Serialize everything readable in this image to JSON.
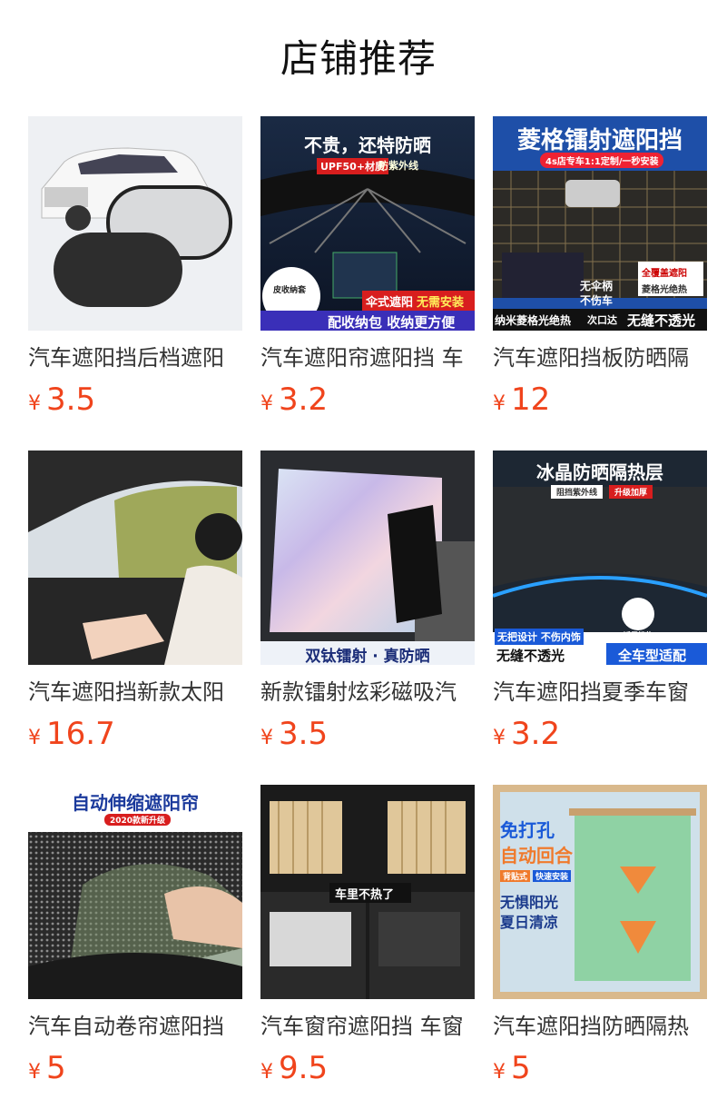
{
  "header": {
    "title": "店铺推荐"
  },
  "products": [
    {
      "title": "汽车遮阳挡后档遮阳",
      "currency": "¥",
      "price": "3.5",
      "image_text": []
    },
    {
      "title": "汽车遮阳帘遮阳挡 车",
      "currency": "¥",
      "price": "3.2",
      "image_text": [
        "不贵，还特防晒",
        "UPF50+材质",
        "防紫外线",
        "皮收纳套",
        "伞式遮阳",
        "无需安装",
        "配收纳包 收纳更方便"
      ]
    },
    {
      "title": "汽车遮阳挡板防晒隔",
      "currency": "¥",
      "price": "12",
      "image_text": [
        "菱格镭射遮阳挡",
        "4s店专车1:1定制/一秒安装",
        "无伞柄",
        "不伤车",
        "全覆盖遮阳",
        "菱格光绝热",
        "纳米菱格光绝热",
        "次口达",
        "无缝不透光"
      ]
    },
    {
      "title": "汽车遮阳挡新款太阳",
      "currency": "¥",
      "price": "16.7",
      "image_text": []
    },
    {
      "title": "新款镭射炫彩磁吸汽",
      "currency": "¥",
      "price": "3.5",
      "image_text": [
        "双钛镭射 · 真防晒"
      ]
    },
    {
      "title": "汽车遮阳挡夏季车窗",
      "currency": "¥",
      "price": "3.2",
      "image_text": [
        "冰晶防晒隔热层",
        "阻挡紫外线",
        "升级加厚",
        "无把设计 不伤内饰",
        "适用挡位",
        "无缝不透光",
        "全车型适配"
      ]
    },
    {
      "title": "汽车自动卷帘遮阳挡",
      "currency": "¥",
      "price": "5",
      "image_text": [
        "自动伸缩遮阳帘",
        "2020款新升级"
      ]
    },
    {
      "title": "汽车窗帘遮阳挡 车窗",
      "currency": "¥",
      "price": "9.5",
      "image_text": [
        "车里不热了"
      ]
    },
    {
      "title": "汽车遮阳挡防晒隔热",
      "currency": "¥",
      "price": "5",
      "image_text": [
        "免打孔",
        "自动回合",
        "背贴式",
        "快速安装",
        "无惧阳光",
        "夏日清凉"
      ]
    }
  ],
  "colors": {
    "price": "#f0441c",
    "title": "#333333"
  }
}
